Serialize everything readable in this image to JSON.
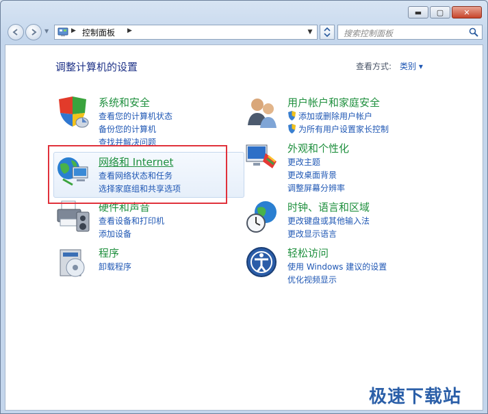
{
  "window": {
    "minimize_glyph": "▬",
    "maximize_glyph": "▢",
    "close_glyph": "✕"
  },
  "address_bar": {
    "path": "控制面板",
    "search_placeholder": "搜索控制面板"
  },
  "header": {
    "title": "调整计算机的设置",
    "view_label": "查看方式:",
    "view_value": "类别 ▾"
  },
  "categories": {
    "system_security": {
      "title": "系统和安全",
      "links": [
        "查看您的计算机状态",
        "备份您的计算机",
        "查找并解决问题"
      ]
    },
    "network": {
      "title": "网络和 Internet",
      "links": [
        "查看网络状态和任务",
        "选择家庭组和共享选项"
      ]
    },
    "hardware": {
      "title": "硬件和声音",
      "links": [
        "查看设备和打印机",
        "添加设备"
      ]
    },
    "programs": {
      "title": "程序",
      "links": [
        "卸载程序"
      ]
    },
    "user_accounts": {
      "title": "用户帐户和家庭安全",
      "links": [
        "添加或删除用户帐户",
        "为所有用户设置家长控制"
      ]
    },
    "appearance": {
      "title": "外观和个性化",
      "links": [
        "更改主题",
        "更改桌面背景",
        "调整屏幕分辨率"
      ]
    },
    "clock": {
      "title": "时钟、语言和区域",
      "links": [
        "更改键盘或其他输入法",
        "更改显示语言"
      ]
    },
    "ease": {
      "title": "轻松访问",
      "links": [
        "使用 Windows 建议的设置",
        "优化视频显示"
      ]
    }
  },
  "watermark": "极速下载站"
}
